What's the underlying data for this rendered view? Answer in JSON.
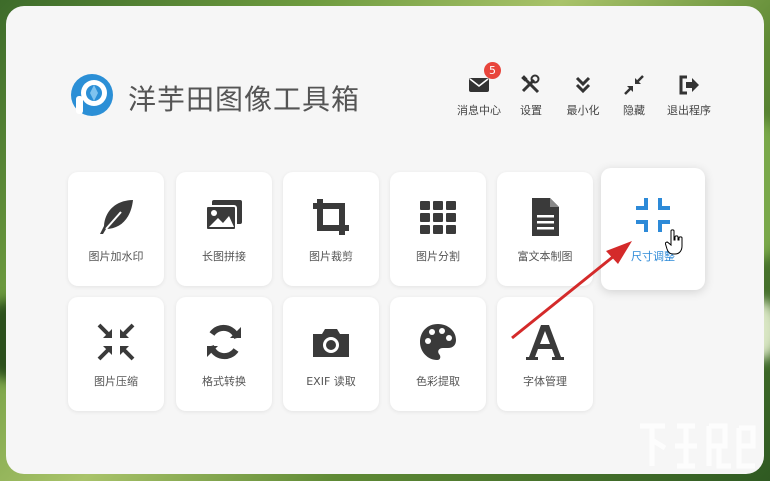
{
  "app": {
    "title": "洋芋田图像工具箱"
  },
  "header_actions": [
    {
      "label": "消息中心",
      "icon": "envelope-icon",
      "badge": "5"
    },
    {
      "label": "设置",
      "icon": "tools-icon"
    },
    {
      "label": "最小化",
      "icon": "chevron-double-down-icon"
    },
    {
      "label": "隐藏",
      "icon": "compress-arrows-icon"
    },
    {
      "label": "退出程序",
      "icon": "sign-out-icon"
    }
  ],
  "tools_row1": [
    {
      "label": "图片加水印",
      "icon": "feather-icon"
    },
    {
      "label": "长图拼接",
      "icon": "images-icon"
    },
    {
      "label": "图片裁剪",
      "icon": "crop-icon"
    },
    {
      "label": "图片分割",
      "icon": "grid-icon"
    },
    {
      "label": "富文本制图",
      "icon": "document-icon"
    },
    {
      "label": "尺寸调整",
      "icon": "resize-compress-icon",
      "active": true
    }
  ],
  "tools_row2": [
    {
      "label": "图片压缩",
      "icon": "compress-icon"
    },
    {
      "label": "格式转换",
      "icon": "sync-icon"
    },
    {
      "label": "EXIF 读取",
      "icon": "camera-icon"
    },
    {
      "label": "色彩提取",
      "icon": "palette-icon"
    },
    {
      "label": "字体管理",
      "icon": "font-icon"
    }
  ],
  "colors": {
    "accent": "#2d8ad8",
    "icon": "#3a3a3a",
    "badge": "#e8453c",
    "arrow": "#d42a2a"
  }
}
